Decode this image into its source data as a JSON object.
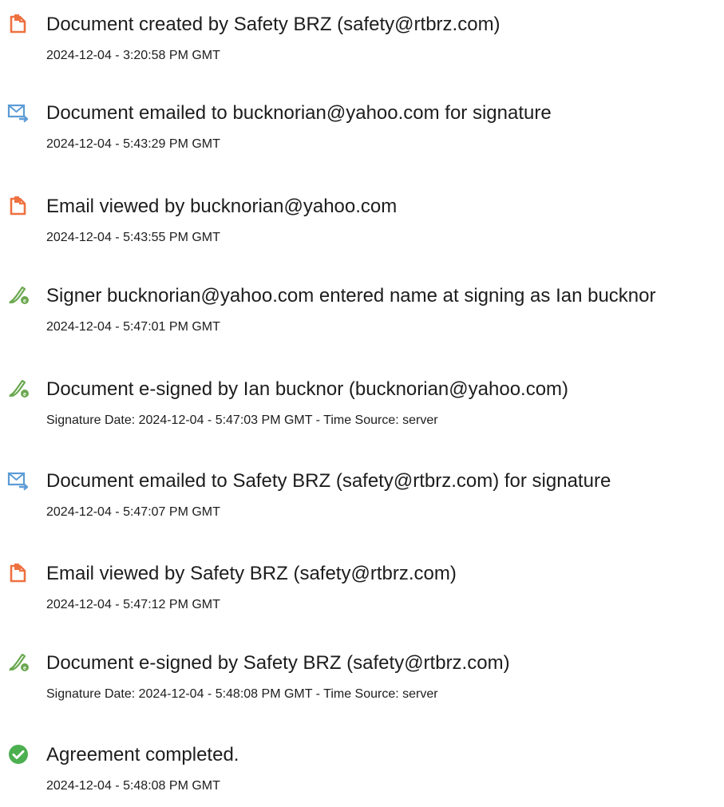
{
  "colors": {
    "document_icon": "#ee7140",
    "email_icon": "#5b9bd5",
    "sign_icon": "#6aa84f",
    "complete_icon": "#4caf50",
    "text": "#1d1d1d"
  },
  "events": [
    {
      "icon": "document-icon",
      "title": "Document created by Safety BRZ (safety@rtbrz.com)",
      "meta": "2024-12-04 - 3:20:58 PM GMT"
    },
    {
      "icon": "email-sent-icon",
      "title": "Document emailed to bucknorian@yahoo.com for signature",
      "meta": "2024-12-04 - 5:43:29 PM GMT"
    },
    {
      "icon": "document-icon",
      "title": "Email viewed by bucknorian@yahoo.com",
      "meta": "2024-12-04 - 5:43:55 PM GMT"
    },
    {
      "icon": "pen-signature-icon",
      "title": "Signer bucknorian@yahoo.com entered name at signing as Ian bucknor",
      "meta": "2024-12-04 - 5:47:01 PM GMT"
    },
    {
      "icon": "pen-signature-icon",
      "title": "Document e-signed by Ian bucknor (bucknorian@yahoo.com)",
      "meta": "Signature Date: 2024-12-04 - 5:47:03 PM GMT - Time Source: server"
    },
    {
      "icon": "email-sent-icon",
      "title": "Document emailed to Safety BRZ (safety@rtbrz.com) for signature",
      "meta": "2024-12-04 - 5:47:07 PM GMT"
    },
    {
      "icon": "document-icon",
      "title": "Email viewed by Safety BRZ (safety@rtbrz.com)",
      "meta": "2024-12-04 - 5:47:12 PM GMT"
    },
    {
      "icon": "pen-signature-icon",
      "title": "Document e-signed by Safety BRZ (safety@rtbrz.com)",
      "meta": "Signature Date: 2024-12-04 - 5:48:08 PM GMT - Time Source: server"
    },
    {
      "icon": "check-circle-icon",
      "title": "Agreement completed.",
      "meta": "2024-12-04 - 5:48:08 PM GMT"
    }
  ]
}
